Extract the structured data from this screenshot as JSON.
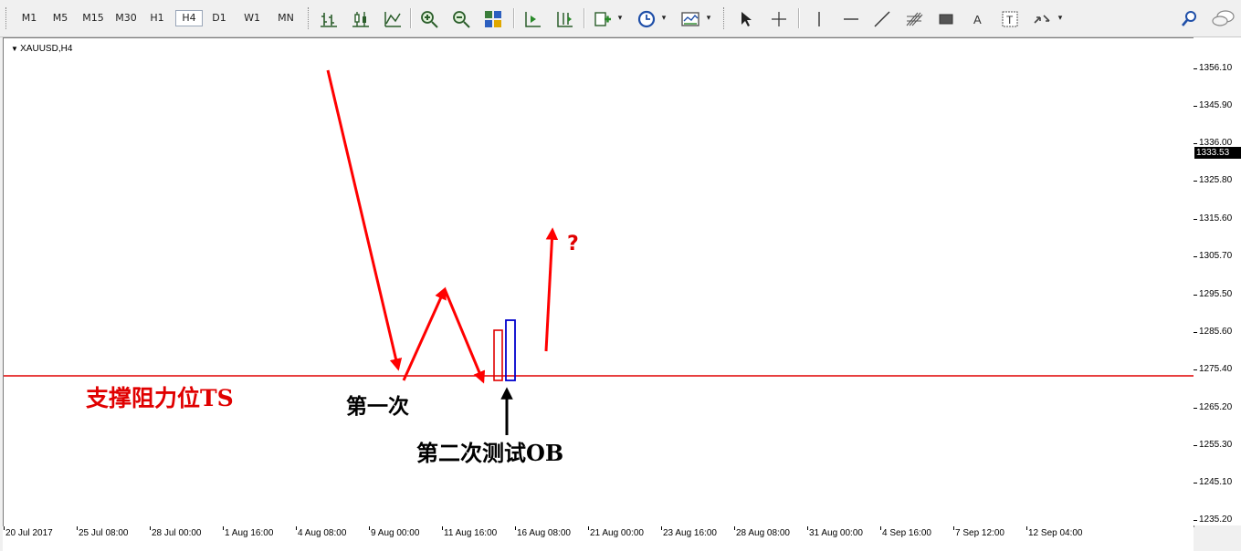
{
  "toolbar": {
    "timeframes": [
      "M1",
      "M5",
      "M15",
      "M30",
      "H1",
      "H4",
      "D1",
      "W1",
      "MN"
    ],
    "active_timeframe": "H4",
    "tools": [
      "bar-chart-icon",
      "candlestick-icon",
      "line-chart-icon",
      "zoom-in-icon",
      "zoom-out-icon",
      "tile-windows-icon",
      "auto-scroll-icon",
      "chart-shift-icon",
      "indicators-icon",
      "periods-icon",
      "templates-icon",
      "cursor-icon",
      "crosshair-icon",
      "vertical-line-icon",
      "horizontal-line-icon",
      "trendline-icon",
      "fibonacci-icon",
      "rectangle-icon",
      "text-icon",
      "text-label-icon",
      "arrows-icon",
      "search-icon",
      "chat-icon"
    ]
  },
  "chart": {
    "symbol": "XAUUSD,H4",
    "current_price": "1333.53",
    "price_ticks": [
      "1356.10",
      "1345.90",
      "1336.00",
      "1325.80",
      "1315.60",
      "1305.70",
      "1295.50",
      "1285.60",
      "1275.40",
      "1265.20",
      "1255.30",
      "1245.10",
      "1235.20"
    ],
    "time_ticks": [
      "20 Jul 2017",
      "25 Jul 08:00",
      "28 Jul 00:00",
      "1 Aug 16:00",
      "4 Aug 08:00",
      "9 Aug 00:00",
      "11 Aug 16:00",
      "16 Aug 08:00",
      "21 Aug 00:00",
      "23 Aug 16:00",
      "28 Aug 08:00",
      "31 Aug 00:00",
      "4 Sep 16:00",
      "7 Sep 12:00",
      "12 Sep 04:00"
    ],
    "colors": {
      "support_line": "#e00000",
      "arrows": "#ff0000",
      "ob_box_red": "#e00000",
      "ob_box_blue": "#0000cc",
      "annotation_black": "#000000"
    }
  },
  "annotations": {
    "support_label": "支撑阻力位TS",
    "first_test": "第一次",
    "second_test": "第二次测试OB",
    "question": "?"
  }
}
